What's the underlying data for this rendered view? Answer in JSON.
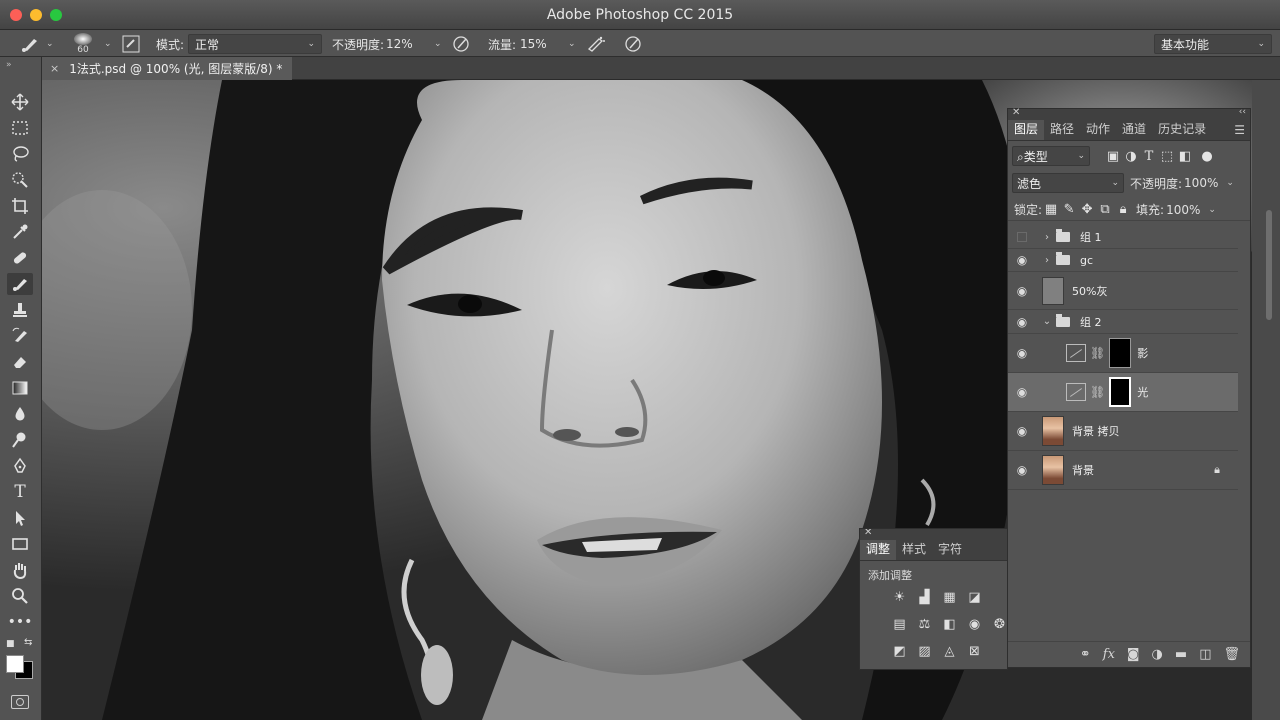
{
  "window": {
    "title": "Adobe Photoshop CC 2015"
  },
  "options_bar": {
    "brush_size": "60",
    "mode_label": "模式:",
    "mode_value": "正常",
    "opacity_label": "不透明度:",
    "opacity_value": "12%",
    "flow_label": "流量:",
    "flow_value": "15%",
    "workspace": "基本功能"
  },
  "document_tab": {
    "close": "×",
    "label": "1法式.psd @ 100% (光, 图层蒙版/8) *"
  },
  "toolbar": {
    "tools": [
      "move-tool",
      "marquee-tool",
      "lasso-tool",
      "quick-selection-tool",
      "crop-tool",
      "eyedropper-tool",
      "healing-brush-tool",
      "brush-tool",
      "clone-stamp-tool",
      "history-brush-tool",
      "eraser-tool",
      "gradient-tool",
      "blur-tool",
      "dodge-tool",
      "pen-tool",
      "type-tool",
      "path-selection-tool",
      "rectangle-tool",
      "hand-tool",
      "zoom-tool",
      "more-tools"
    ],
    "active_tool": "brush-tool",
    "type_tool_glyph": "T"
  },
  "layers_panel": {
    "tabs": [
      "图层",
      "路径",
      "动作",
      "通道",
      "历史记录"
    ],
    "active_tab": "图层",
    "filter_kind": "类型",
    "blend_mode": "滤色",
    "opacity_label": "不透明度:",
    "opacity_value": "100%",
    "lock_label": "锁定:",
    "fill_label": "填充:",
    "fill_value": "100%",
    "layers": [
      {
        "name": "组 1",
        "kind": "group",
        "visible": false,
        "expanded": false
      },
      {
        "name": "gc",
        "kind": "group",
        "visible": true,
        "expanded": false
      },
      {
        "name": "50%灰",
        "kind": "fill-gray",
        "visible": true
      },
      {
        "name": "组 2",
        "kind": "group",
        "visible": true,
        "expanded": true
      },
      {
        "name": "影",
        "kind": "curves-mask",
        "visible": true,
        "indented": true
      },
      {
        "name": "光",
        "kind": "curves-mask",
        "visible": true,
        "indented": true,
        "selected": true
      },
      {
        "name": "背景 拷贝",
        "kind": "photo",
        "visible": true
      },
      {
        "name": "背景",
        "kind": "photo",
        "visible": true,
        "locked": true
      }
    ],
    "footer_icons": [
      "link-icon",
      "fx-icon",
      "mask-icon",
      "adjustment-icon",
      "new-group-icon",
      "new-layer-icon",
      "trash-icon"
    ],
    "fx_label": "fx"
  },
  "adjustments_panel": {
    "tabs": [
      "调整",
      "样式",
      "字符"
    ],
    "active_tab": "调整",
    "title": "添加调整"
  },
  "colors": {
    "chrome": "#535353",
    "dark_chrome": "#404040",
    "selected_layer": "#6b6b6b",
    "close_red": "#fc5f57",
    "min_yellow": "#fdbc2e",
    "max_green": "#28c840"
  }
}
